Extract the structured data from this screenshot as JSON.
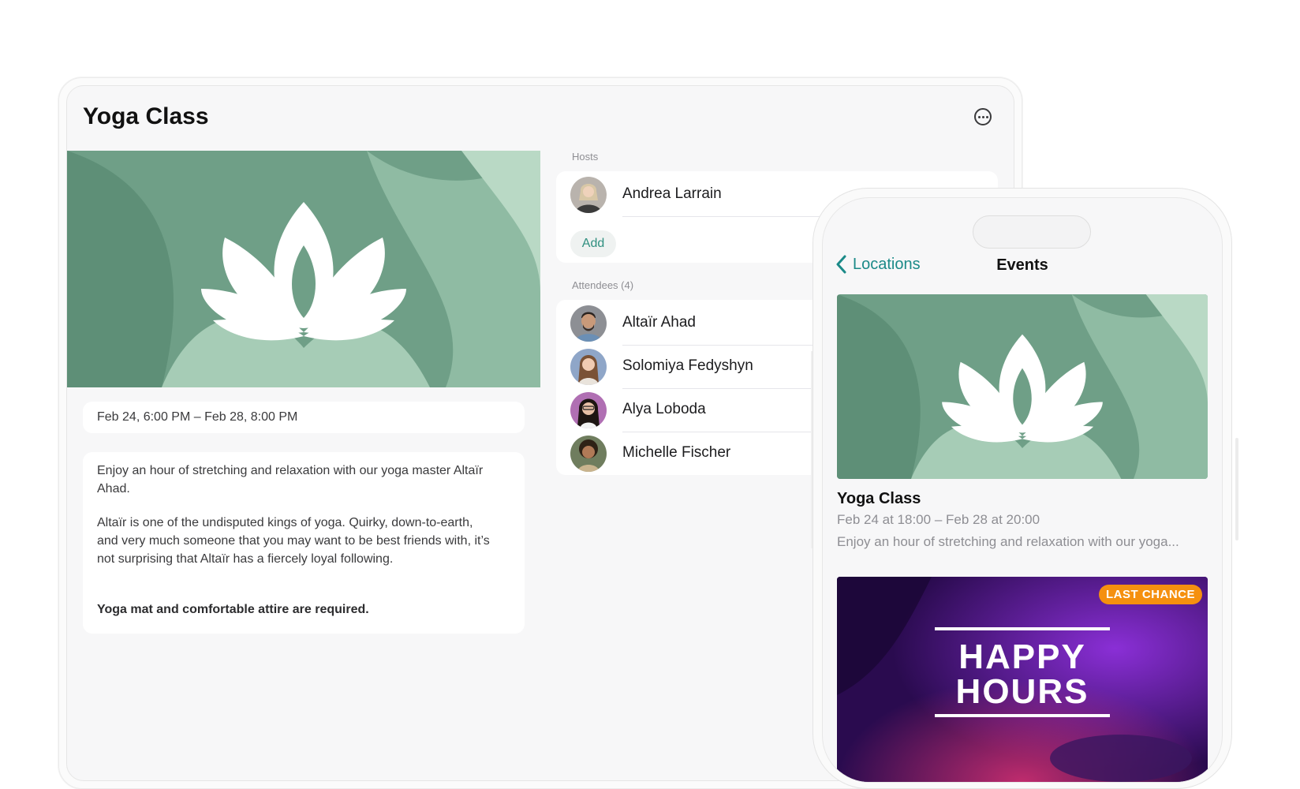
{
  "tablet": {
    "title": "Yoga Class",
    "more_icon": "ellipsis-circle-icon",
    "date_range": "Feb 24, 6:00 PM – Feb 28, 8:00 PM",
    "description": [
      "Enjoy an hour of stretching and relaxation with our yoga master Altaïr Ahad.",
      "Altaïr is one of the undisputed kings of yoga. Quirky, down-to-earth, and very much someone that you may want to be best friends with, it’s not surprising that Altaïr has a fiercely loyal following.",
      "Yoga mat and comfortable attire are required."
    ],
    "hosts_label": "Hosts",
    "hosts": [
      {
        "name": "Andrea Larrain"
      }
    ],
    "add_label": "Add",
    "attendees_label": "Attendees (4)",
    "attendees": [
      {
        "name": "Altaïr Ahad"
      },
      {
        "name": "Solomiya Fedyshyn"
      },
      {
        "name": "Alya Loboda"
      },
      {
        "name": "Michelle Fischer"
      }
    ]
  },
  "phone": {
    "back_label": "Locations",
    "nav_title": "Events",
    "event": {
      "title": "Yoga Class",
      "date": "Feb 24 at 18:00 – Feb 28 at 20:00",
      "description": "Enjoy an hour of stretching and relaxation with our yoga..."
    },
    "promo": {
      "badge": "LAST CHANCE",
      "line1": "HAPPY",
      "line2": "HOURS"
    }
  },
  "colors": {
    "accent": "#1b8a88",
    "hero_green": "#6f9f87",
    "badge_orange": "#f5900f"
  }
}
